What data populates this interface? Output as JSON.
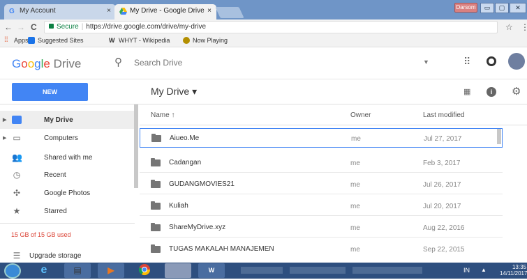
{
  "browser": {
    "tabs": [
      {
        "label": "My Account",
        "active": false
      },
      {
        "label": "My Drive - Google Drive",
        "active": true
      }
    ],
    "tab_close": "×",
    "user_chip": "Darsom",
    "window_buttons": {
      "minimize": "▭",
      "maximize": "▢",
      "close": "✕"
    },
    "address": {
      "secure_label": "Secure",
      "url": "https://drive.google.com/drive/my-drive"
    },
    "nav": {
      "back": "←",
      "forward": "→",
      "reload": "C"
    },
    "star": "☆",
    "menu": "⋮",
    "bookmarks": [
      {
        "label": "Apps",
        "color": "#e34f26"
      },
      {
        "label": "Suggested Sites",
        "color": "#1a73e8"
      },
      {
        "label": "WHYT - Wikipedia",
        "color": "#333333"
      },
      {
        "label": "Now Playing",
        "color": "#b38f00"
      }
    ]
  },
  "drive": {
    "logo_google": [
      "G",
      "o",
      "o",
      "g",
      "l",
      "e"
    ],
    "logo_product": "Drive",
    "search_placeholder": "Search Drive",
    "new_button": "NEW",
    "breadcrumb": "My Drive ▾",
    "sidebar": {
      "items": [
        {
          "label": "My Drive",
          "icon": "drive-icon",
          "active": true,
          "expandable": true
        },
        {
          "label": "Computers",
          "icon": "computer-icon",
          "active": false,
          "expandable": true
        },
        {
          "label": "Shared with me",
          "icon": "people-icon",
          "active": false,
          "expandable": false
        },
        {
          "label": "Recent",
          "icon": "clock-icon",
          "active": false,
          "expandable": false
        },
        {
          "label": "Google Photos",
          "icon": "pinwheel-icon",
          "active": false,
          "expandable": false
        },
        {
          "label": "Starred",
          "icon": "star-icon",
          "active": false,
          "expandable": false
        }
      ],
      "storage_text": "15 GB of 15 GB used",
      "upgrade_label": "Upgrade storage"
    },
    "columns": {
      "name": "Name ↑",
      "owner": "Owner",
      "modified": "Last modified"
    },
    "files": [
      {
        "name": "Aiueo.Me",
        "owner": "me",
        "modified": "Jul 27, 2017"
      },
      {
        "name": "Cadangan",
        "owner": "me",
        "modified": "Feb 3, 2017"
      },
      {
        "name": "GUDANGMOVIES21",
        "owner": "me",
        "modified": "Jul 26, 2017"
      },
      {
        "name": "Kuliah",
        "owner": "me",
        "modified": "Jul 20, 2017"
      },
      {
        "name": "ShareMyDrive.xyz",
        "owner": "me",
        "modified": "Aug 22, 2016"
      },
      {
        "name": "TUGAS MAKALAH MANAJEMEN",
        "owner": "me",
        "modified": "Sep 22, 2015"
      }
    ]
  },
  "taskbar": {
    "language": "IN",
    "tray_arrow": "▲",
    "time": "13:35",
    "date": "14/11/2017"
  }
}
